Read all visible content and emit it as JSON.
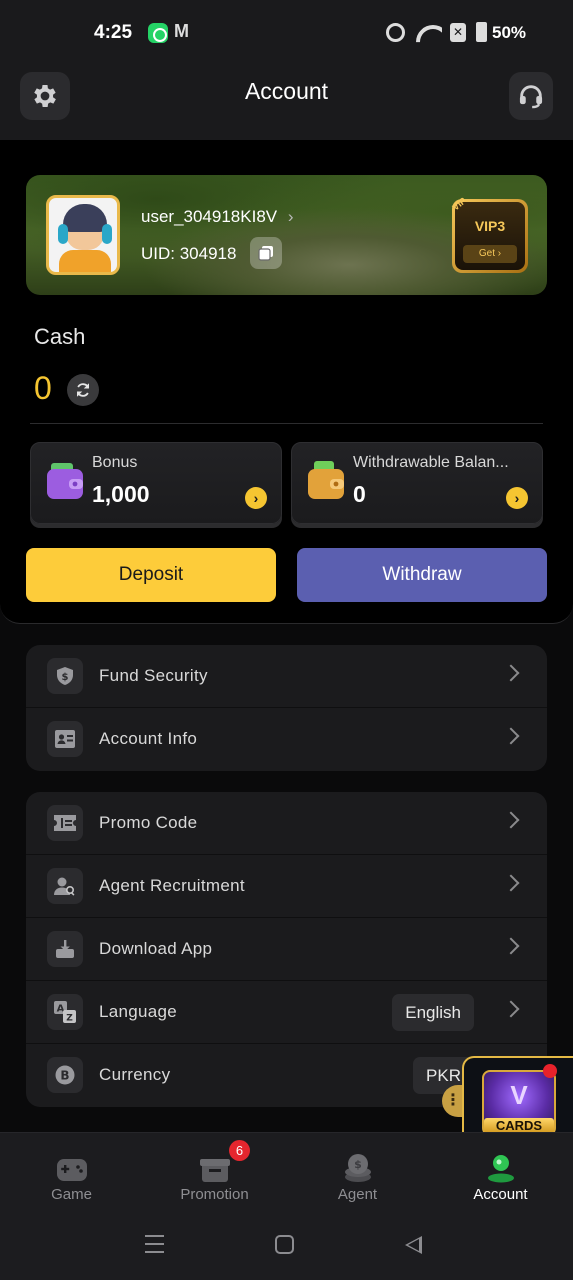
{
  "status_bar": {
    "time": "4:25",
    "battery": "50%",
    "mail_glyph": "M",
    "sim_glyph": "✕"
  },
  "header": {
    "title": "Account",
    "settings_icon": "gear-icon",
    "support_icon": "headset-icon"
  },
  "profile": {
    "username": "user_304918KI8V",
    "username_arrow": "›",
    "uid": "UID: 304918",
    "vip_corner": "VIP",
    "vip_level": "VIP3",
    "vip_get": "Get ›"
  },
  "wallet": {
    "cash_label": "Cash",
    "cash_value": "0",
    "bonus_label": "Bonus",
    "bonus_value": "1,000",
    "withdrawable_label": "Withdrawable Balan...",
    "withdrawable_value": "0",
    "card_arrow": "›",
    "deposit_label": "Deposit",
    "withdraw_label": "Withdraw"
  },
  "menu_group_1": [
    {
      "label": "Fund Security",
      "icon": "shield-dollar-icon"
    },
    {
      "label": "Account Info",
      "icon": "id-card-icon"
    }
  ],
  "menu_group_2": [
    {
      "label": "Promo Code",
      "icon": "ticket-icon"
    },
    {
      "label": "Agent Recruitment",
      "icon": "agent-search-icon"
    },
    {
      "label": "Download App",
      "icon": "download-icon"
    },
    {
      "label": "Language",
      "icon": "translate-icon",
      "value": "English"
    },
    {
      "label": "Currency",
      "icon": "bitcoin-icon",
      "value": "PKR"
    }
  ],
  "floating_widget": {
    "label": "CARDS",
    "letter": "V",
    "handle": "⋮"
  },
  "tabs": [
    {
      "label": "Game",
      "icon": "gamepad-icon"
    },
    {
      "label": "Promotion",
      "icon": "gift-icon",
      "badge": "6"
    },
    {
      "label": "Agent",
      "icon": "coins-icon"
    },
    {
      "label": "Account",
      "icon": "user-icon",
      "active": true
    }
  ],
  "colors": {
    "accent": "#fdcc3a",
    "withdraw": "#5b5fb0",
    "background": "#000000",
    "surface": "#1b1b1d"
  }
}
